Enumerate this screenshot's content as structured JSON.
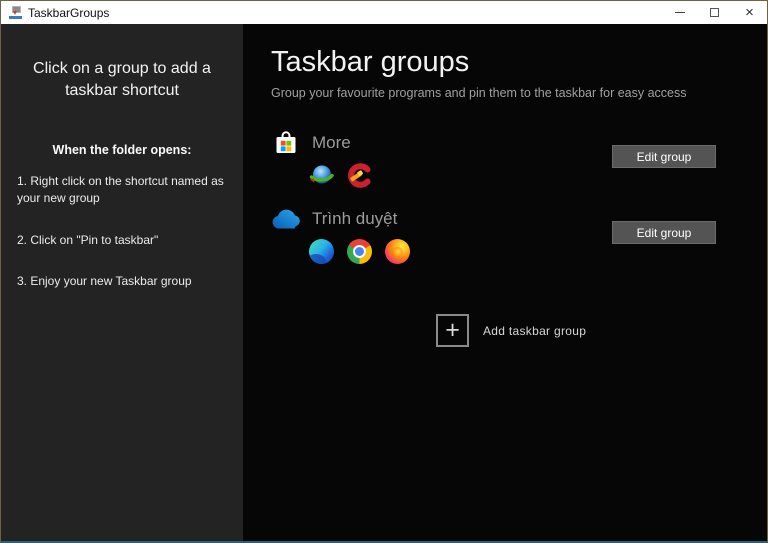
{
  "window": {
    "title": "TaskbarGroups",
    "controls": {
      "close_glyph": "×"
    }
  },
  "sidebar": {
    "heading": "Click on a group to add a taskbar shortcut",
    "folder_note": "When the folder opens:",
    "steps": [
      "1. Right click on the shortcut named as your new group",
      "2. Click on \"Pin to taskbar\"",
      "3. Enjoy your new Taskbar group"
    ]
  },
  "main": {
    "title": "Taskbar groups",
    "subtitle": "Group your favourite programs and pin them to the taskbar for easy access",
    "groups": [
      {
        "name": "More",
        "icon": "microsoft-store-icon",
        "apps": [
          "internet-download-manager-icon",
          "ccleaner-icon"
        ],
        "edit_label": "Edit group"
      },
      {
        "name": "Trình duyệt",
        "icon": "onedrive-icon",
        "apps": [
          "microsoft-edge-icon",
          "google-chrome-icon",
          "firefox-icon"
        ],
        "edit_label": "Edit group"
      }
    ],
    "add_group": {
      "label": "Add taskbar group",
      "plus_glyph": "+"
    }
  },
  "colors": {
    "titlebar_bg": "#ffffff",
    "sidebar_bg": "#232323",
    "main_bg": "#060606",
    "edit_button_bg": "#545454",
    "bottom_accent_border": "#2d5f78",
    "store_red": "#f25022",
    "store_green": "#7fba00",
    "store_blue": "#00a4ef",
    "store_yellow": "#ffb900"
  }
}
